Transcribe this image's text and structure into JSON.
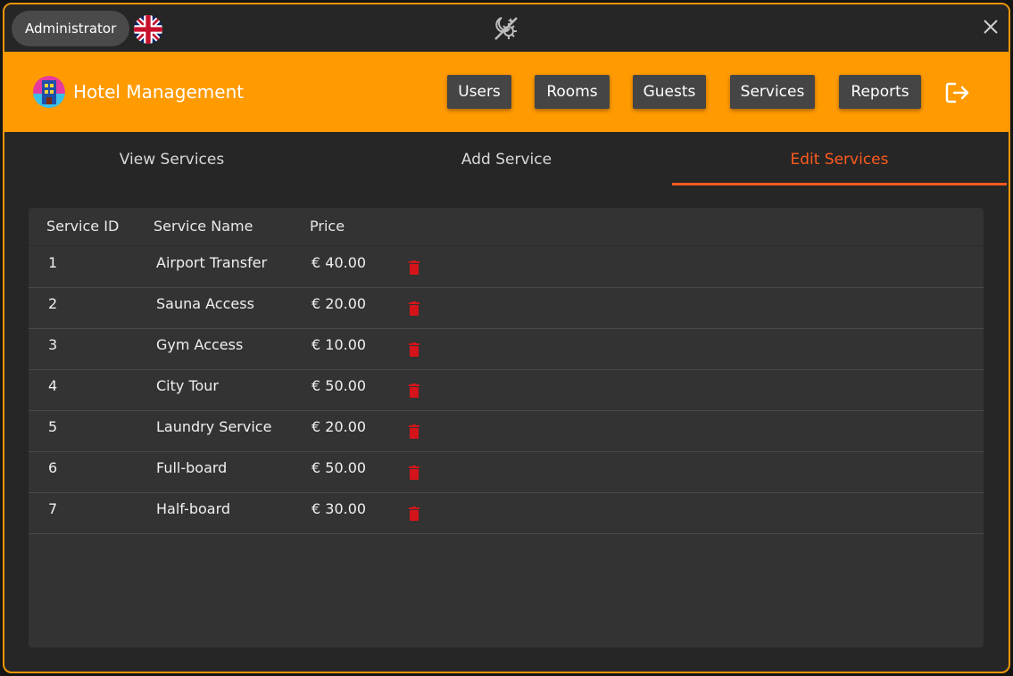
{
  "titlebar": {
    "role_label": "Administrator",
    "language_icon": "uk-flag-icon",
    "theme_icon": "day-night-toggle-icon",
    "close_icon": "close-icon"
  },
  "header": {
    "title": "Hotel Management",
    "logo_icon": "hotel-logo-icon",
    "nav": [
      "Users",
      "Rooms",
      "Guests",
      "Services",
      "Reports"
    ],
    "logout_icon": "logout-icon"
  },
  "tabs": {
    "items": [
      "View Services",
      "Add Service",
      "Edit Services"
    ],
    "active_index": 2
  },
  "table": {
    "columns": [
      "Service ID",
      "Service Name",
      "Price"
    ],
    "rows": [
      {
        "id": "1",
        "name": "Airport Transfer",
        "price": "€ 40.00"
      },
      {
        "id": "2",
        "name": "Sauna Access",
        "price": "€ 20.00"
      },
      {
        "id": "3",
        "name": "Gym Access",
        "price": "€ 10.00"
      },
      {
        "id": "4",
        "name": "City Tour",
        "price": "€ 50.00"
      },
      {
        "id": "5",
        "name": "Laundry Service",
        "price": "€ 20.00"
      },
      {
        "id": "6",
        "name": "Full-board",
        "price": "€ 50.00"
      },
      {
        "id": "7",
        "name": "Half-board",
        "price": "€ 30.00"
      }
    ],
    "delete_icon": "trash-icon"
  },
  "colors": {
    "accent": "#ff9a00",
    "active_tab": "#ff5a1f",
    "delete": "#d4141a",
    "background": "#262626",
    "card": "#333333"
  }
}
